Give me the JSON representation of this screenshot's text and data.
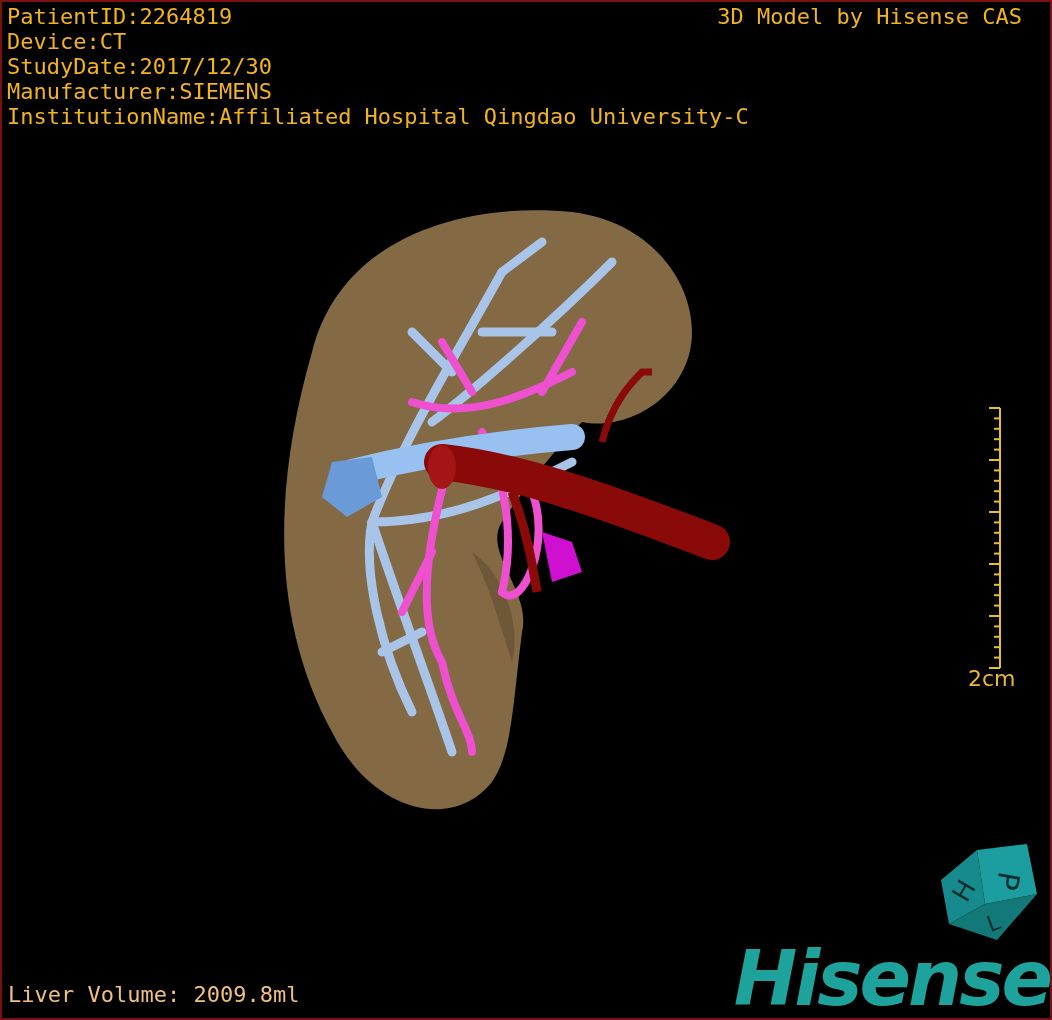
{
  "info_lines": [
    "PatientID:2264819",
    "Device:CT",
    "StudyDate:2017/12/30",
    "Manufacturer:SIEMENS",
    "InstitutionName:Affiliated Hospital Qingdao University-C"
  ],
  "title": "3D Model by Hisense CAS",
  "scale_bar": {
    "label": "2cm"
  },
  "orientation_cube": {
    "faces": [
      "P",
      "H",
      "L"
    ]
  },
  "logo": "Hisense",
  "footer": "Liver Volume: 2009.8ml"
}
